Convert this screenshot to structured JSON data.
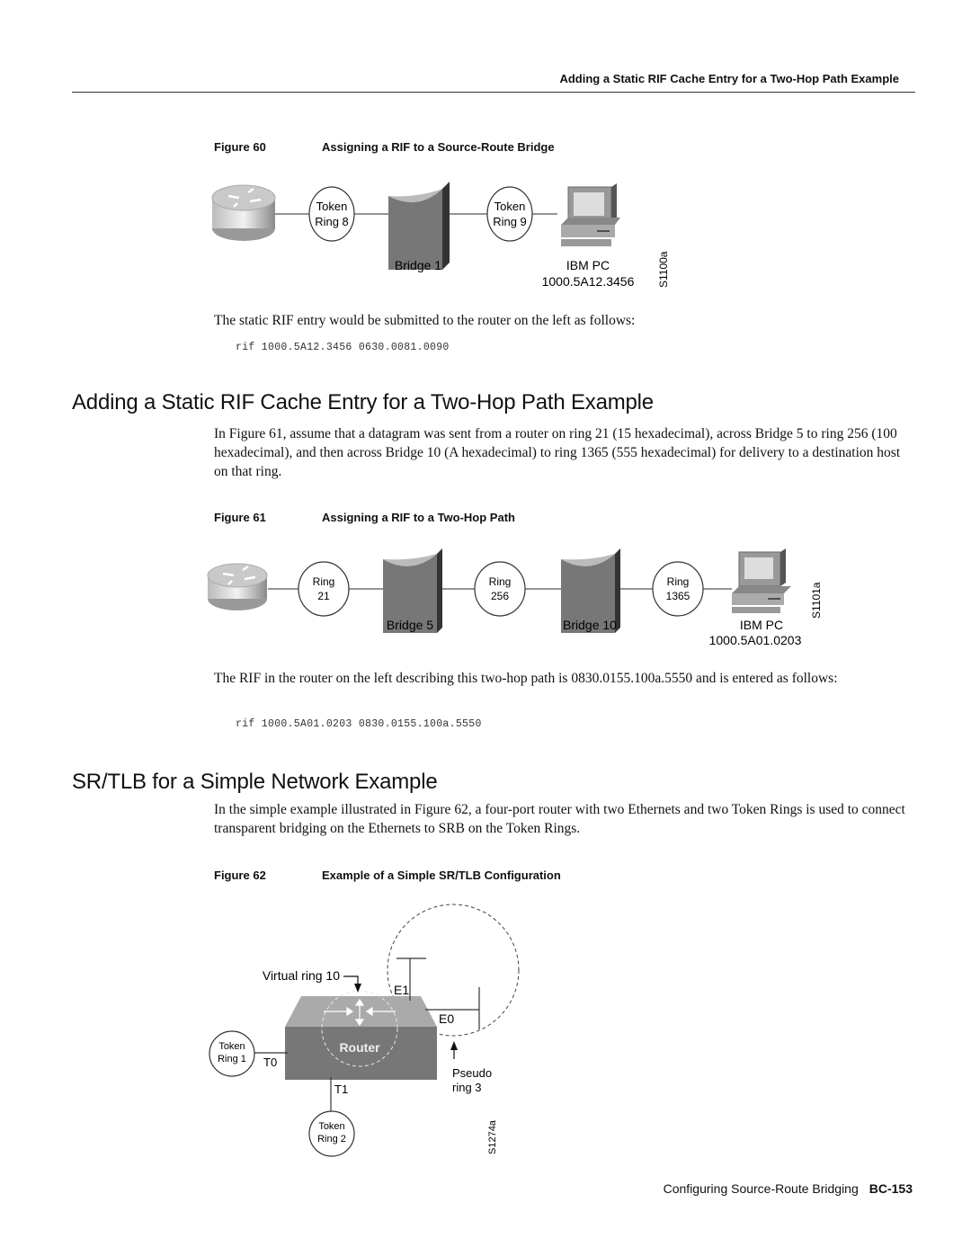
{
  "running_head": "Adding a Static RIF Cache Entry for a Two-Hop Path Example",
  "figure60": {
    "number": "Figure 60",
    "title": "Assigning a RIF to a Source-Route Bridge",
    "ring_a": [
      "Token",
      "Ring 8"
    ],
    "ring_b": [
      "Token",
      "Ring 9"
    ],
    "bridge_label": "Bridge 1",
    "pc_label": "IBM PC",
    "pc_address": "1000.5A12.3456",
    "fig_id": "S1100a"
  },
  "para1": "The static RIF entry would be submitted to the router on the left as follows:",
  "code1": "rif 1000.5A12.3456 0630.0081.0090",
  "heading1": "Adding a Static RIF Cache Entry for a Two-Hop Path Example",
  "para2": "In Figure 61, assume that a datagram was sent from a router on ring 21 (15 hexadecimal), across Bridge 5 to ring 256 (100 hexadecimal), and then across Bridge 10 (A hexadecimal) to ring 1365 (555 hexadecimal) for delivery to a destination host on that ring.",
  "figure61": {
    "number": "Figure 61",
    "title": "Assigning a RIF to a Two-Hop Path",
    "ring_a": [
      "Ring",
      "21"
    ],
    "ring_b": [
      "Ring",
      "256"
    ],
    "ring_c": [
      "Ring",
      "1365"
    ],
    "bridge_a": "Bridge 5",
    "bridge_b": "Bridge 10",
    "pc_label": "IBM PC",
    "pc_address": "1000.5A01.0203",
    "fig_id": "S1101a"
  },
  "para3": "The RIF in the router on the left describing this two-hop path is 0830.0155.100a.5550 and is entered as follows:",
  "code2": "rif 1000.5A01.0203 0830.0155.100a.5550",
  "heading2": "SR/TLB for a Simple Network Example",
  "para4": "In the simple example illustrated in Figure 62, a four-port router with two Ethernets and two Token Rings is used to connect transparent bridging on the Ethernets to SRB on the Token Rings.",
  "figure62": {
    "number": "Figure 62",
    "title": "Example of a Simple SR/TLB Configuration",
    "virtual_ring": "Virtual ring 10",
    "router_label": "Router",
    "e1": "E1",
    "e0": "E0",
    "t0": "T0",
    "t1": "T1",
    "token_ring1": [
      "Token",
      "Ring 1"
    ],
    "token_ring2": [
      "Token",
      "Ring 2"
    ],
    "pseudo_ring": [
      "Pseudo",
      "ring 3"
    ],
    "fig_id": "S1274a"
  },
  "footer": {
    "chapter": "Configuring Source-Route Bridging",
    "page": "BC-153"
  }
}
